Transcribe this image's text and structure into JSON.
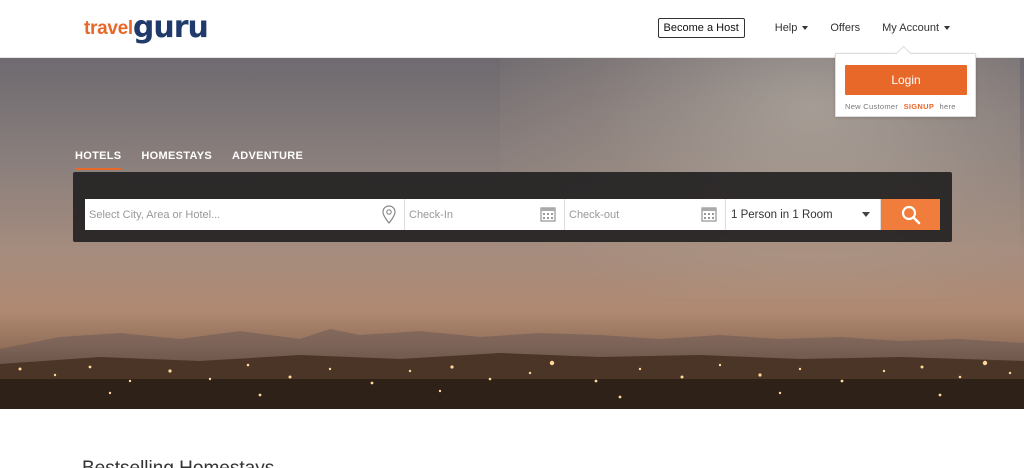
{
  "brand": {
    "logo_left": "travel",
    "logo_right": "guru",
    "accent": "#e8682a",
    "navy": "#1f3a6b"
  },
  "nav": {
    "become_host": "Become a Host",
    "help": "Help",
    "offers": "Offers",
    "my_account": "My Account"
  },
  "login_popup": {
    "login_label": "Login",
    "new_customer": "New Customer",
    "signup": "SIGNUP",
    "here": "here"
  },
  "tabs": [
    {
      "label": "HOTELS",
      "active": true
    },
    {
      "label": "HOMESTAYS",
      "active": false
    },
    {
      "label": "ADVENTURE",
      "active": false
    }
  ],
  "search": {
    "city_placeholder": "Select City, Area or Hotel...",
    "checkin_placeholder": "Check-In",
    "checkout_placeholder": "Check-out",
    "guests_value": "1 Person in 1 Room",
    "icons": {
      "location": "map-pin-icon",
      "calendar": "calendar-icon",
      "search": "search-icon"
    }
  },
  "sections": {
    "bestselling_title": "Bestselling Homestays"
  }
}
